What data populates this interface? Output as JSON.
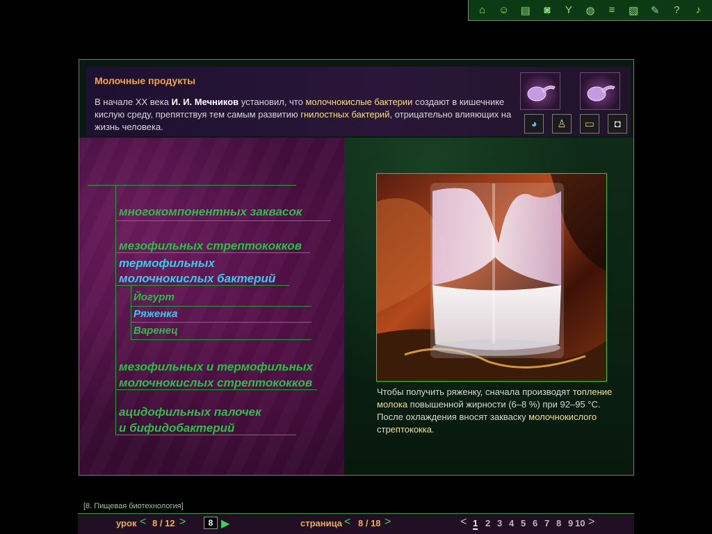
{
  "toolbar": {
    "icons": [
      "home-icon",
      "people-icon",
      "book-icon",
      "camera-icon",
      "molecule-icon",
      "globe-icon",
      "stack-icon",
      "document-icon",
      "notes-icon",
      "help-icon",
      "sound-icon"
    ]
  },
  "header": {
    "title": "Молочные продукты",
    "text_1": "В начале XX века ",
    "person": "И. И. Мечников",
    "text_2": " установил, что ",
    "term_1": "молочнокислые бактерии",
    "text_3": " создают в кишечнике кислую среду, препятствуя тем самым развитию ",
    "term_2": "гнилостных бактерий",
    "text_4": ", отрицательно влияющих на жизнь человека."
  },
  "list": {
    "item_1": "многокомпонентных заквасок",
    "item_2": "мезофильных стрептококков",
    "item_3_line1": "термофильных",
    "item_3_line2": "молочнокислых бактерий",
    "sub_1": "Йогурт",
    "sub_2": "Ряженка",
    "sub_3": "Варенец",
    "item_4_line1": "мезофильных и термофильных",
    "item_4_line2": "молочнокислых стрептококков",
    "item_5_line1": "ацидофильных палочек",
    "item_5_line2": "и бифидобактерий"
  },
  "caption": {
    "text_1": "Чтобы получить ряженку, сначала производят ",
    "term_1": "топление молока",
    "text_2": " повышенной жирности (6–8 %) при 92–95 °С. После охлаждения вносят закваску ",
    "term_2": "молочнокислого стрептококка",
    "text_3": "."
  },
  "breadcrumb": "[8. Пищевая биотехнология]",
  "footer": {
    "lesson_label": "урок",
    "lesson_value": "8 / 12",
    "goto_value": "8",
    "page_label": "страница",
    "page_value": "8 / 18",
    "pages": [
      "1",
      "2",
      "3",
      "4",
      "5",
      "6",
      "7",
      "8",
      "9",
      "10"
    ]
  },
  "colors": {
    "accent_green": "#28c045",
    "active_cyan": "#2fd0f0",
    "highlight_yellow": "#f4e27a",
    "title_orange": "#f0a64a"
  }
}
